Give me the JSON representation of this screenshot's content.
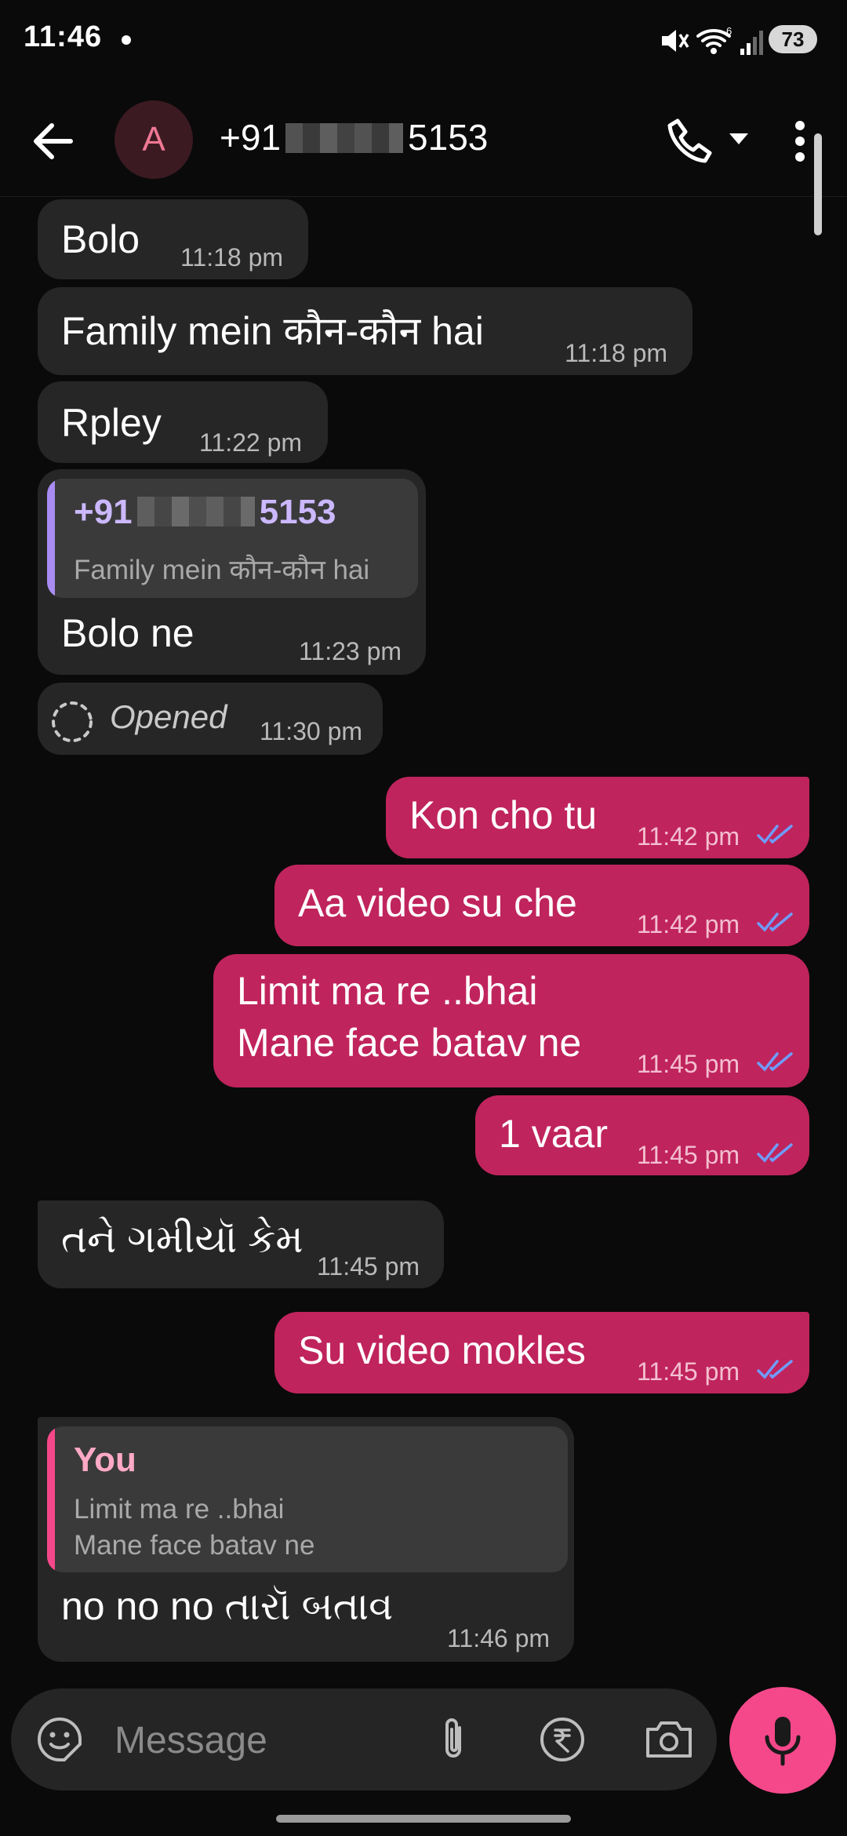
{
  "status_bar": {
    "time": "11:46",
    "battery": "73"
  },
  "header": {
    "avatar_letter": "A",
    "contact_prefix": "+91",
    "contact_suffix": "5153"
  },
  "messages": [
    {
      "dir": "in",
      "text": "Bolo",
      "time": "11:18 pm"
    },
    {
      "dir": "in",
      "text": "Family mein कौन-कौन hai",
      "time": "11:18 pm"
    },
    {
      "dir": "in",
      "text": "Rpley",
      "time": "11:22 pm"
    },
    {
      "dir": "in",
      "quote": {
        "author_prefix": "+91",
        "author_suffix": "5153",
        "text": "Family mein कौन-कौन hai"
      },
      "text": "Bolo ne",
      "time": "11:23 pm"
    },
    {
      "dir": "in",
      "status": "Opened",
      "time": "11:30 pm"
    },
    {
      "dir": "out",
      "text": "Kon cho tu",
      "time": "11:42 pm"
    },
    {
      "dir": "out",
      "text": "Aa video  su che",
      "time": "11:42 pm"
    },
    {
      "dir": "out",
      "lines": [
        "Limit ma re ..bhai",
        "Mane face batav ne"
      ],
      "time": "11:45 pm"
    },
    {
      "dir": "out",
      "text": "1 vaar",
      "time": "11:45 pm"
    },
    {
      "dir": "in",
      "text": "તને ગમીયૉ કેમ",
      "time": "11:45 pm"
    },
    {
      "dir": "out",
      "text": "Su video mokles",
      "time": "11:45 pm"
    },
    {
      "dir": "in",
      "quote": {
        "author": "You",
        "lines": [
          "Limit ma re ..bhai",
          "Mane face batav ne"
        ]
      },
      "text": "no no no તારૉ બતાવ",
      "time": "11:46 pm"
    }
  ],
  "composer": {
    "placeholder": "Message"
  },
  "colors": {
    "incoming_bubble": "#262626",
    "outgoing_bubble": "#c0245c",
    "mic_button": "#f5488a",
    "quote_bar_contact": "#a98cf2",
    "quote_bar_you": "#f5488a",
    "read_ticks": "#6f9cff"
  }
}
